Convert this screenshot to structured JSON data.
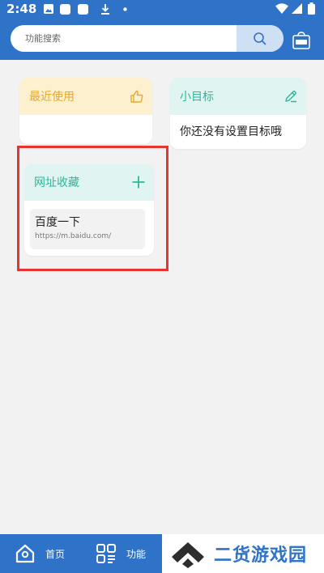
{
  "status_bar": {
    "time": "2:48",
    "icons": [
      "image-icon",
      "app-icon",
      "app-icon",
      "download-icon",
      "dot-icon",
      "wifi-icon",
      "signal-icon",
      "battery-icon"
    ]
  },
  "search": {
    "placeholder": "功能搜索",
    "button_icon": "search-icon",
    "new_icon": "new-badge-icon"
  },
  "cards": {
    "recent": {
      "title": "最近使用",
      "icon": "thumb-up-icon"
    },
    "goal": {
      "title": "小目标",
      "icon": "edit-icon",
      "empty_text": "你还没有设置目标哦"
    },
    "favorites": {
      "title": "网址收藏",
      "icon": "plus-icon",
      "items": [
        {
          "name": "百度一下",
          "url": "https://m.baidu.com/"
        }
      ]
    }
  },
  "bottom_nav": {
    "items": [
      {
        "label": "首页",
        "icon": "home-icon"
      },
      {
        "label": "功能",
        "icon": "grid-icon"
      }
    ]
  },
  "watermark": {
    "text": "二货游戏园"
  },
  "colors": {
    "primary": "#2f73c9",
    "recent_header": "#fdf0cf",
    "recent_accent": "#e6a92f",
    "teal_header": "#e0f5f1",
    "teal_accent": "#2bb79a",
    "highlight": "#e8342e"
  }
}
